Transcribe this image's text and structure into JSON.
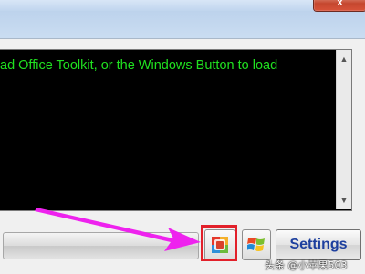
{
  "window": {
    "close_glyph": "x"
  },
  "console": {
    "text": "ad Office Toolkit, or the Windows Button to load",
    "text_color": "#20E020",
    "background": "#000000"
  },
  "scrollbar": {
    "up_glyph": "▲",
    "down_glyph": "▼"
  },
  "toolbar": {
    "settings_label": "Settings",
    "settings_color": "#1D3F9E",
    "office_button_icon": "office-logo-icon",
    "windows_button_icon": "windows-logo-icon"
  },
  "annotation": {
    "arrow_color": "#EE22EE",
    "highlight_color": "#E2202A"
  },
  "watermark": {
    "text": "头条 @小苹果503"
  }
}
